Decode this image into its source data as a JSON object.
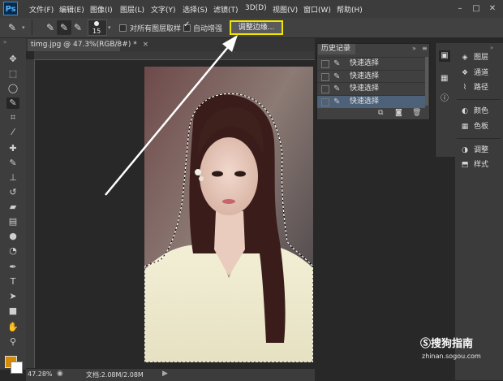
{
  "app": {
    "logo": "Ps",
    "menu": [
      "文件(F)",
      "编辑(E)",
      "图像(I)",
      "图层(L)",
      "文字(Y)",
      "选择(S)",
      "滤镜(T)",
      "3D(D)",
      "视图(V)",
      "窗口(W)",
      "帮助(H)"
    ],
    "window_controls": [
      "minimize-icon",
      "maximize-icon",
      "close-icon"
    ]
  },
  "options_bar": {
    "brush_size": "15",
    "sample_all_layers_label": "对所有图层取样",
    "sample_all_layers_checked": false,
    "auto_enhance_label": "自动增强",
    "auto_enhance_checked": true,
    "refine_edge_label": "调整边缘..."
  },
  "document": {
    "tab_title": "timg.jpg @ 47.3%(RGB/8#) *",
    "zoom": "47.28%",
    "doc_info": "文档:2.08M/2.08M"
  },
  "history_panel": {
    "title": "历史记录",
    "items": [
      {
        "label": "快速选择",
        "selected": false
      },
      {
        "label": "快速选择",
        "selected": false
      },
      {
        "label": "快速选择",
        "selected": false
      },
      {
        "label": "快速选择",
        "selected": true
      }
    ]
  },
  "right_panel": {
    "items": [
      {
        "icon": "layers-icon",
        "label": "图层"
      },
      {
        "icon": "channels-icon",
        "label": "通道"
      },
      {
        "icon": "paths-icon",
        "label": "路径"
      },
      {
        "icon": "color-icon",
        "label": "颜色"
      },
      {
        "icon": "swatches-icon",
        "label": "色板"
      },
      {
        "icon": "adjustments-icon",
        "label": "调整"
      },
      {
        "icon": "styles-icon",
        "label": "样式"
      }
    ]
  },
  "colors": {
    "foreground": "#d88a00",
    "background": "#ffffff",
    "highlight_box": "#f2e500"
  },
  "watermark": {
    "logo_text": "搜狗指南",
    "url": "zhinan.sogou.com"
  }
}
